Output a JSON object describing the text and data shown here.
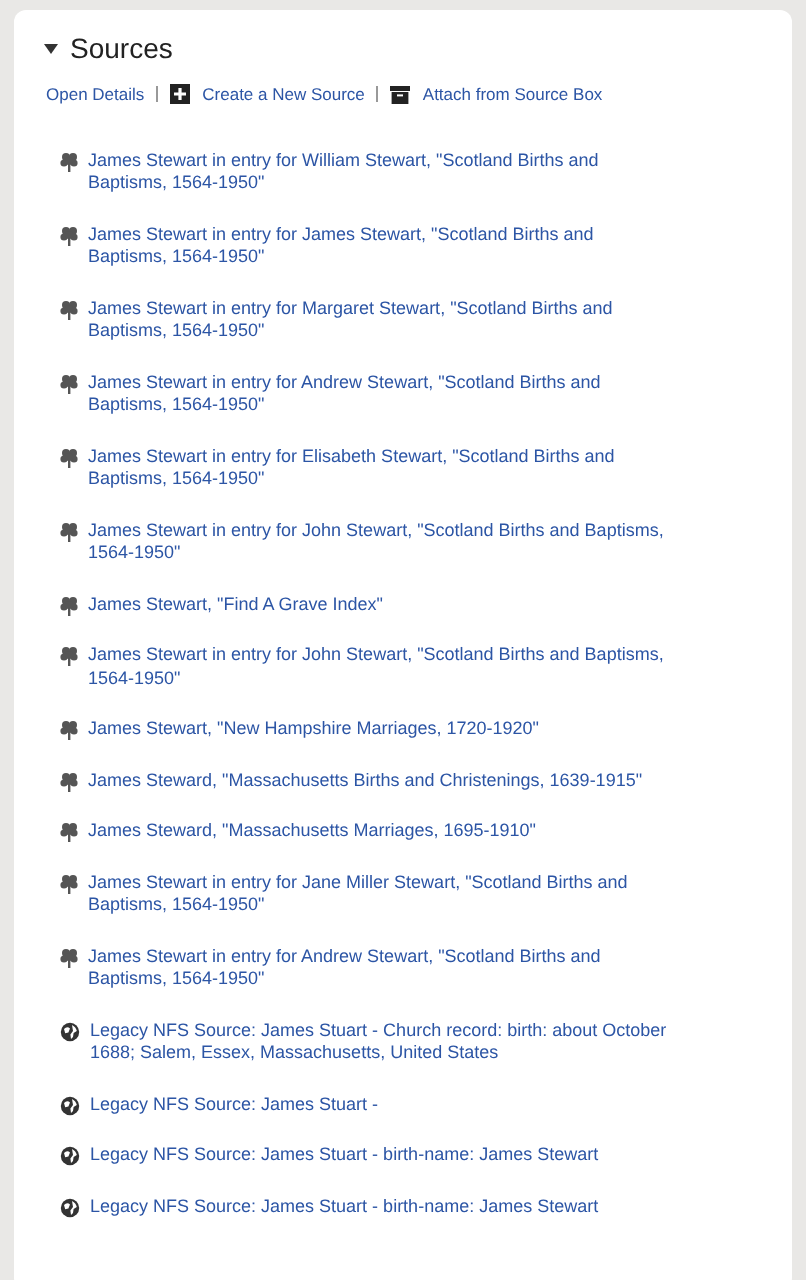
{
  "section": {
    "title": "Sources",
    "expanded": true
  },
  "actions": [
    {
      "label": "Open Details",
      "kind": "text"
    },
    {
      "label": "Create a New Source",
      "kind": "add"
    },
    {
      "label": "Attach from Source Box",
      "kind": "box"
    }
  ],
  "sources": [
    {
      "kind": "record",
      "text": "James Stewart in entry for William Stewart, \"Scotland Births and Baptisms, 1564-1950\""
    },
    {
      "kind": "record",
      "text": "James Stewart in entry for James Stewart, \"Scotland Births and Baptisms, 1564-1950\""
    },
    {
      "kind": "record",
      "text": "James Stewart in entry for Margaret Stewart, \"Scotland Births and Baptisms, 1564-1950\""
    },
    {
      "kind": "record",
      "text": "James Stewart in entry for Andrew Stewart, \"Scotland Births and Baptisms, 1564-1950\""
    },
    {
      "kind": "record",
      "text": "James Stewart in entry for Elisabeth Stewart, \"Scotland Births and Baptisms, 1564-1950\""
    },
    {
      "kind": "record",
      "text": "James Stewart in entry for John Stewart, \"Scotland Births and Baptisms, 1564-1950\""
    },
    {
      "kind": "record",
      "text": "James Stewart, \"Find A Grave Index\""
    },
    {
      "kind": "record",
      "text": "James Stewart in entry for John Stewart, \"Scotland Births and Baptisms, 1564-1950\""
    },
    {
      "kind": "record",
      "text": "James Stewart, \"New Hampshire Marriages, 1720-1920\""
    },
    {
      "kind": "record",
      "text": "James Steward, \"Massachusetts Births and Christenings, 1639-1915\""
    },
    {
      "kind": "record",
      "text": "James Steward, \"Massachusetts Marriages, 1695-1910\""
    },
    {
      "kind": "record",
      "text": "James Stewart in entry for Jane Miller Stewart, \"Scotland Births and Baptisms, 1564-1950\""
    },
    {
      "kind": "record",
      "text": "James Stewart in entry for Andrew Stewart, \"Scotland Births and Baptisms, 1564-1950\""
    },
    {
      "kind": "web",
      "text": "Legacy NFS Source: James Stuart - Church record: birth: about October 1688; Salem, Essex, Massachusetts, United States"
    },
    {
      "kind": "web",
      "text": "Legacy NFS Source: James Stuart -"
    },
    {
      "kind": "web",
      "text": "Legacy NFS Source: James Stuart - birth-name: James Stewart"
    },
    {
      "kind": "web",
      "text": "Legacy NFS Source: James Stuart - birth-name: James Stewart"
    }
  ]
}
